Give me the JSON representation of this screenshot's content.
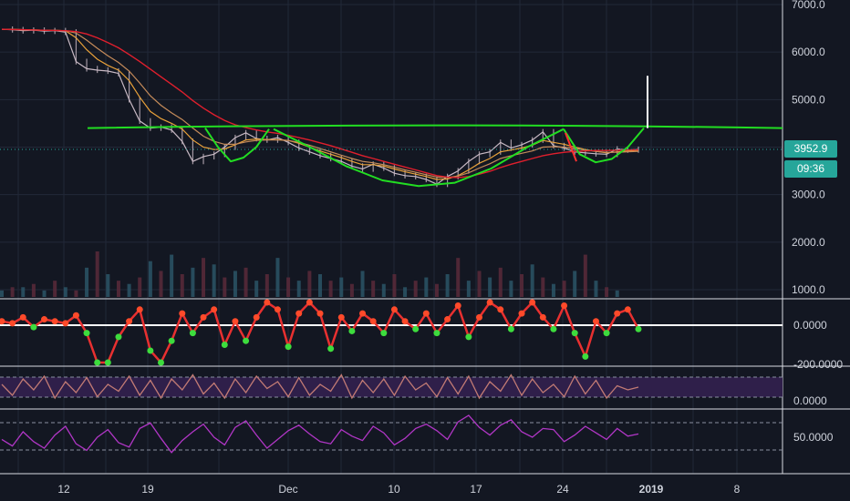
{
  "chart_data": [
    {
      "type": "line",
      "pane": "price",
      "y_ticks": [
        "7000.0",
        "6000.0",
        "5000.0",
        "4000.0",
        "3000.0",
        "2000.0",
        "1000.0"
      ],
      "ylim": [
        700,
        7050
      ],
      "x_labels": [
        "12",
        "19",
        "Dec",
        "10",
        "17",
        "24",
        "2019",
        "8"
      ],
      "last_price": "3952.9",
      "countdown": "09:36",
      "colors": {
        "candles": "#c8b9c4",
        "ma_fast": "#e8a13a",
        "ma_mid": "#c58b5a",
        "ma_slow": "#e01f2d",
        "pattern": "#22dd22",
        "annotation_up": "#ffffff",
        "annotation_down": "#ff3030",
        "badge": "#26a69a"
      },
      "series": [
        {
          "values": [
            6480,
            6470,
            6450,
            6460,
            6440,
            6450,
            6420,
            5800,
            5650,
            5620,
            5600,
            5550,
            5000,
            4550,
            4400,
            4420,
            4360,
            4120,
            3700,
            3800,
            3850,
            4000,
            4200,
            4300,
            4180,
            4150,
            4200,
            4100,
            3980,
            3900,
            3820,
            3760,
            3700,
            3600,
            3540,
            3640,
            3560,
            3450,
            3400,
            3380,
            3320,
            3220,
            3380,
            3500,
            3700,
            3850,
            3900,
            4100,
            3980,
            4050,
            4150,
            4320,
            4030,
            3980,
            3900,
            3880,
            3860,
            3850,
            3960,
            3940,
            3952
          ]
        },
        {
          "values": [
            6480,
            6478,
            6470,
            6465,
            6460,
            6455,
            6450,
            6300,
            6050,
            5850,
            5720,
            5620,
            5400,
            5050,
            4750,
            4600,
            4500,
            4380,
            4150,
            4000,
            3950,
            3960,
            4050,
            4150,
            4170,
            4160,
            4160,
            4140,
            4080,
            4000,
            3920,
            3850,
            3780,
            3700,
            3630,
            3630,
            3600,
            3540,
            3480,
            3430,
            3380,
            3320,
            3330,
            3400,
            3520,
            3660,
            3760,
            3900,
            3940,
            3980,
            4040,
            4140,
            4100,
            4060,
            4000,
            3950,
            3910,
            3880,
            3900,
            3920,
            3930
          ]
        },
        {
          "values": [
            6480,
            6475,
            6470,
            6465,
            6460,
            6455,
            6450,
            6400,
            6250,
            6080,
            5920,
            5780,
            5600,
            5350,
            5080,
            4880,
            4720,
            4580,
            4400,
            4230,
            4120,
            4060,
            4060,
            4110,
            4140,
            4150,
            4150,
            4140,
            4100,
            4040,
            3970,
            3900,
            3830,
            3760,
            3700,
            3670,
            3630,
            3580,
            3520,
            3470,
            3420,
            3370,
            3360,
            3390,
            3460,
            3560,
            3650,
            3760,
            3820,
            3870,
            3920,
            4000,
            4010,
            4000,
            3970,
            3940,
            3910,
            3890,
            3890,
            3900,
            3910
          ]
        },
        {
          "values": [
            6480,
            6475,
            6470,
            6465,
            6460,
            6455,
            6450,
            6430,
            6380,
            6300,
            6200,
            6090,
            5950,
            5800,
            5640,
            5480,
            5320,
            5160,
            4980,
            4820,
            4680,
            4560,
            4470,
            4410,
            4360,
            4320,
            4290,
            4250,
            4200,
            4150,
            4090,
            4030,
            3960,
            3890,
            3820,
            3760,
            3700,
            3640,
            3580,
            3520,
            3460,
            3400,
            3370,
            3360,
            3380,
            3430,
            3490,
            3570,
            3640,
            3700,
            3760,
            3820,
            3860,
            3890,
            3910,
            3920,
            3930,
            3930,
            3935,
            3940,
            3945
          ]
        }
      ],
      "pattern_overlay": {
        "rim_level": 4400,
        "cup": [
          [
            4400,
            4000,
            3700,
            3780,
            4000,
            4380
          ],
          [
            4380,
            4000,
            3600,
            3300,
            3180,
            3250,
            3550,
            4000,
            4380
          ],
          [
            4380,
            3850,
            3680,
            3750,
            4000,
            4400
          ]
        ],
        "breakout_top": 5500,
        "sell_line": [
          4300,
          3700
        ]
      }
    },
    {
      "type": "bar",
      "pane": "volume",
      "values": [
        2,
        3,
        3,
        4,
        2,
        5,
        3,
        2,
        9,
        14,
        7,
        5,
        4,
        6,
        11,
        8,
        13,
        7,
        9,
        12,
        10,
        6,
        8,
        9,
        5,
        7,
        12,
        6,
        5,
        8,
        7,
        5,
        6,
        4,
        8,
        5,
        4,
        7,
        3,
        5,
        6,
        4,
        7,
        12,
        5,
        8,
        6,
        9,
        5,
        7,
        10,
        6,
        4,
        5,
        8,
        13,
        5,
        3,
        2,
        0,
        0
      ]
    },
    {
      "type": "line",
      "pane": "oscillator-1",
      "y_ticks": [
        "0.0000",
        "-200.0000"
      ],
      "values": [
        20,
        10,
        40,
        -10,
        30,
        20,
        10,
        50,
        -40,
        -350,
        -200,
        -60,
        20,
        80,
        -130,
        -220,
        -80,
        60,
        -40,
        40,
        80,
        -100,
        20,
        -80,
        40,
        180,
        80,
        -110,
        60,
        140,
        60,
        -120,
        40,
        -30,
        60,
        20,
        -40,
        80,
        20,
        -20,
        60,
        -40,
        30,
        100,
        -60,
        40,
        160,
        80,
        -20,
        60,
        140,
        40,
        -20,
        100,
        -40,
        -160,
        20,
        -40,
        60,
        80,
        -20
      ]
    },
    {
      "type": "line",
      "pane": "oscillator-2",
      "y_ticks": [
        "0.0000"
      ],
      "values": [
        0.6,
        0.2,
        0.8,
        0.4,
        0.9,
        0.1,
        0.7,
        0.3,
        0.85,
        0.15,
        0.6,
        0.35,
        0.9,
        0.2,
        0.75,
        0.1,
        0.8,
        0.4,
        0.95,
        0.25,
        0.65,
        0.1,
        0.8,
        0.3,
        0.9,
        0.45,
        0.7,
        0.15,
        0.85,
        0.2,
        0.6,
        0.35,
        0.95,
        0.1,
        0.75,
        0.3,
        0.8,
        0.2,
        0.9,
        0.4,
        0.65,
        0.15,
        0.85,
        0.25,
        0.9,
        0.1,
        0.7,
        0.35,
        0.95,
        0.2,
        0.8,
        0.3,
        0.6,
        0.15,
        0.9,
        0.25,
        0.75,
        0.1,
        0.55,
        0.4,
        0.5
      ]
    },
    {
      "type": "line",
      "pane": "oscillator-3",
      "y_ticks": [
        "50.0000"
      ],
      "values": [
        48,
        42,
        55,
        46,
        40,
        52,
        60,
        44,
        38,
        50,
        57,
        45,
        41,
        58,
        63,
        49,
        36,
        47,
        55,
        62,
        50,
        43,
        59,
        65,
        52,
        40,
        48,
        56,
        61,
        53,
        46,
        44,
        57,
        51,
        47,
        60,
        54,
        43,
        49,
        58,
        62,
        56,
        48,
        64,
        70,
        59,
        52,
        61,
        66,
        55,
        50,
        58,
        57,
        46,
        52,
        60,
        54,
        48,
        58,
        51,
        53
      ]
    }
  ]
}
